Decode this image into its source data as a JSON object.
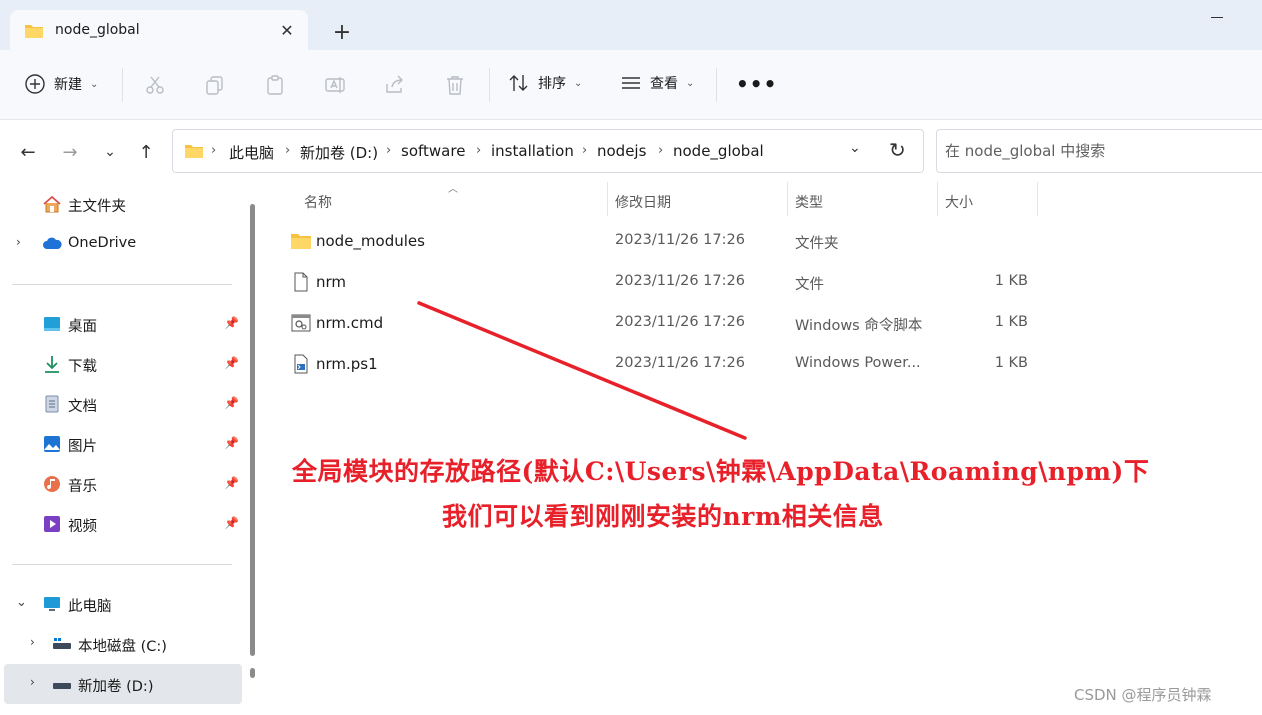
{
  "window": {
    "tab_title": "node_global",
    "tab_close": "✕",
    "new_tab": "+"
  },
  "toolbar": {
    "new_label": "新建",
    "sort_label": "排序",
    "view_label": "查看",
    "more_label": "•••"
  },
  "address": {
    "crumbs": [
      "此电脑",
      "新加卷 (D:)",
      "software",
      "installation",
      "nodejs",
      "node_global"
    ],
    "search_placeholder": "在 node_global 中搜索"
  },
  "sidebar": {
    "quick": [
      {
        "label": "主文件夹"
      },
      {
        "label": "OneDrive"
      }
    ],
    "pinned": [
      {
        "label": "桌面"
      },
      {
        "label": "下载"
      },
      {
        "label": "文档"
      },
      {
        "label": "图片"
      },
      {
        "label": "音乐"
      },
      {
        "label": "视频"
      }
    ],
    "pc": [
      {
        "label": "此电脑"
      },
      {
        "label": "本地磁盘 (C:)"
      },
      {
        "label": "新加卷 (D:)"
      }
    ]
  },
  "columns": {
    "name": "名称",
    "modified": "修改日期",
    "type": "类型",
    "size": "大小"
  },
  "files": [
    {
      "name": "node_modules",
      "modified": "2023/11/26 17:26",
      "type": "文件夹",
      "size": ""
    },
    {
      "name": "nrm",
      "modified": "2023/11/26 17:26",
      "type": "文件",
      "size": "1 KB"
    },
    {
      "name": "nrm.cmd",
      "modified": "2023/11/26 17:26",
      "type": "Windows 命令脚本",
      "size": "1 KB"
    },
    {
      "name": "nrm.ps1",
      "modified": "2023/11/26 17:26",
      "type": "Windows Power...",
      "size": "1 KB"
    }
  ],
  "annotation": {
    "line1": "全局模块的存放路径(默认C:\\Users\\钟霖\\AppData\\Roaming\\npm)下",
    "line2": "我们可以看到刚刚安装的nrm相关信息",
    "color": "#e8202a"
  },
  "watermark": "CSDN @程序员钟霖"
}
